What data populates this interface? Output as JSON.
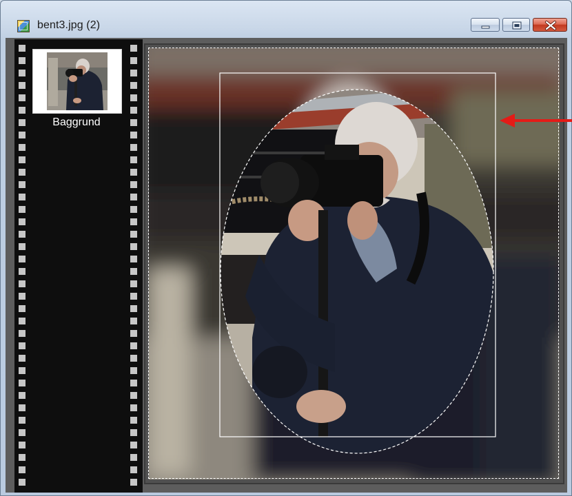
{
  "window": {
    "title": "bent3.jpg (2)",
    "icon": "image-document-icon",
    "controls": {
      "minimize": "minimize-icon",
      "maximize": "maximize-icon",
      "close": "close-icon"
    }
  },
  "layers_panel": {
    "layers": [
      {
        "label": "Baggrund",
        "thumbnail": "photographer-thumbnail"
      }
    ]
  },
  "canvas": {
    "image": "photographer-with-camera-photo",
    "selection": "ellipse-selection",
    "bounding_box": "selection-bounding-box"
  },
  "annotation": {
    "arrow_color": "#e41b17",
    "arrow": "red-arrow-icon"
  }
}
